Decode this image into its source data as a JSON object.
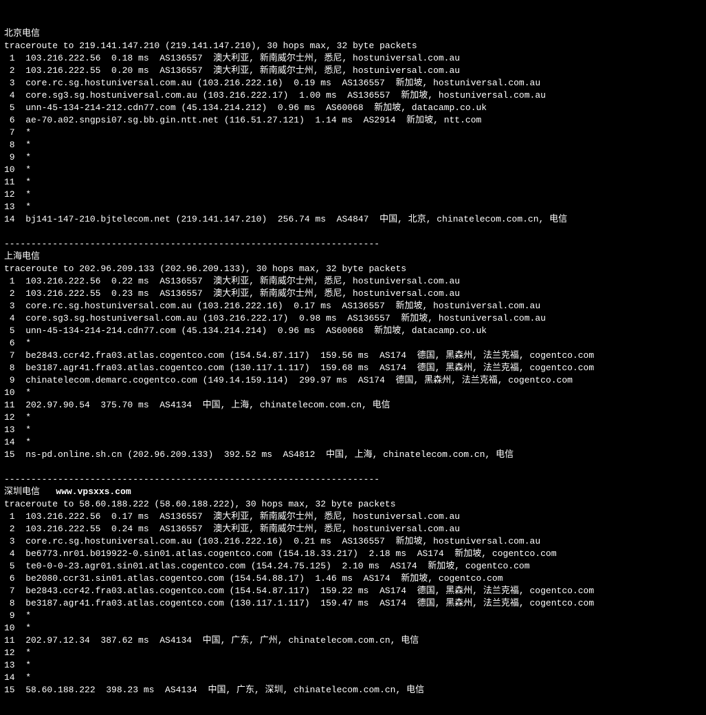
{
  "separator": "----------------------------------------------------------------------",
  "sections": [
    {
      "title": "北京电信",
      "watermark": "",
      "header": "traceroute to 219.141.147.210 (219.141.147.210), 30 hops max, 32 byte packets",
      "hops": [
        {
          "n": 1,
          "text": "103.216.222.56  0.18 ms  AS136557  澳大利亚, 新南威尔士州, 悉尼, hostuniversal.com.au"
        },
        {
          "n": 2,
          "text": "103.216.222.55  0.20 ms  AS136557  澳大利亚, 新南威尔士州, 悉尼, hostuniversal.com.au"
        },
        {
          "n": 3,
          "text": "core.rc.sg.hostuniversal.com.au (103.216.222.16)  0.19 ms  AS136557  新加坡, hostuniversal.com.au"
        },
        {
          "n": 4,
          "text": "core.sg3.sg.hostuniversal.com.au (103.216.222.17)  1.00 ms  AS136557  新加坡, hostuniversal.com.au"
        },
        {
          "n": 5,
          "text": "unn-45-134-214-212.cdn77.com (45.134.214.212)  0.96 ms  AS60068  新加坡, datacamp.co.uk"
        },
        {
          "n": 6,
          "text": "ae-70.a02.sngpsi07.sg.bb.gin.ntt.net (116.51.27.121)  1.14 ms  AS2914  新加坡, ntt.com"
        },
        {
          "n": 7,
          "text": "*"
        },
        {
          "n": 8,
          "text": "*"
        },
        {
          "n": 9,
          "text": "*"
        },
        {
          "n": 10,
          "text": "*"
        },
        {
          "n": 11,
          "text": "*"
        },
        {
          "n": 12,
          "text": "*"
        },
        {
          "n": 13,
          "text": "*"
        },
        {
          "n": 14,
          "text": "bj141-147-210.bjtelecom.net (219.141.147.210)  256.74 ms  AS4847  中国, 北京, chinatelecom.com.cn, 电信"
        }
      ]
    },
    {
      "title": "上海电信",
      "watermark": "",
      "header": "traceroute to 202.96.209.133 (202.96.209.133), 30 hops max, 32 byte packets",
      "hops": [
        {
          "n": 1,
          "text": "103.216.222.56  0.22 ms  AS136557  澳大利亚, 新南威尔士州, 悉尼, hostuniversal.com.au"
        },
        {
          "n": 2,
          "text": "103.216.222.55  0.23 ms  AS136557  澳大利亚, 新南威尔士州, 悉尼, hostuniversal.com.au"
        },
        {
          "n": 3,
          "text": "core.rc.sg.hostuniversal.com.au (103.216.222.16)  0.17 ms  AS136557  新加坡, hostuniversal.com.au"
        },
        {
          "n": 4,
          "text": "core.sg3.sg.hostuniversal.com.au (103.216.222.17)  0.98 ms  AS136557  新加坡, hostuniversal.com.au"
        },
        {
          "n": 5,
          "text": "unn-45-134-214-214.cdn77.com (45.134.214.214)  0.96 ms  AS60068  新加坡, datacamp.co.uk"
        },
        {
          "n": 6,
          "text": "*"
        },
        {
          "n": 7,
          "text": "be2843.ccr42.fra03.atlas.cogentco.com (154.54.87.117)  159.56 ms  AS174  德国, 黑森州, 法兰克福, cogentco.com"
        },
        {
          "n": 8,
          "text": "be3187.agr41.fra03.atlas.cogentco.com (130.117.1.117)  159.68 ms  AS174  德国, 黑森州, 法兰克福, cogentco.com"
        },
        {
          "n": 9,
          "text": "chinatelecom.demarc.cogentco.com (149.14.159.114)  299.97 ms  AS174  德国, 黑森州, 法兰克福, cogentco.com"
        },
        {
          "n": 10,
          "text": "*"
        },
        {
          "n": 11,
          "text": "202.97.90.54  375.70 ms  AS4134  中国, 上海, chinatelecom.com.cn, 电信"
        },
        {
          "n": 12,
          "text": "*"
        },
        {
          "n": 13,
          "text": "*"
        },
        {
          "n": 14,
          "text": "*"
        },
        {
          "n": 15,
          "text": "ns-pd.online.sh.cn (202.96.209.133)  392.52 ms  AS4812  中国, 上海, chinatelecom.com.cn, 电信"
        }
      ]
    },
    {
      "title": "深圳电信",
      "watermark": "www.vpsxxs.com",
      "header": "traceroute to 58.60.188.222 (58.60.188.222), 30 hops max, 32 byte packets",
      "hops": [
        {
          "n": 1,
          "text": "103.216.222.56  0.17 ms  AS136557  澳大利亚, 新南威尔士州, 悉尼, hostuniversal.com.au"
        },
        {
          "n": 2,
          "text": "103.216.222.55  0.24 ms  AS136557  澳大利亚, 新南威尔士州, 悉尼, hostuniversal.com.au"
        },
        {
          "n": 3,
          "text": "core.rc.sg.hostuniversal.com.au (103.216.222.16)  0.21 ms  AS136557  新加坡, hostuniversal.com.au"
        },
        {
          "n": 4,
          "text": "be6773.nr01.b019922-0.sin01.atlas.cogentco.com (154.18.33.217)  2.18 ms  AS174  新加坡, cogentco.com"
        },
        {
          "n": 5,
          "text": "te0-0-0-23.agr01.sin01.atlas.cogentco.com (154.24.75.125)  2.10 ms  AS174  新加坡, cogentco.com"
        },
        {
          "n": 6,
          "text": "be2080.ccr31.sin01.atlas.cogentco.com (154.54.88.17)  1.46 ms  AS174  新加坡, cogentco.com"
        },
        {
          "n": 7,
          "text": "be2843.ccr42.fra03.atlas.cogentco.com (154.54.87.117)  159.22 ms  AS174  德国, 黑森州, 法兰克福, cogentco.com"
        },
        {
          "n": 8,
          "text": "be3187.agr41.fra03.atlas.cogentco.com (130.117.1.117)  159.47 ms  AS174  德国, 黑森州, 法兰克福, cogentco.com"
        },
        {
          "n": 9,
          "text": "*"
        },
        {
          "n": 10,
          "text": "*"
        },
        {
          "n": 11,
          "text": "202.97.12.34  387.62 ms  AS4134  中国, 广东, 广州, chinatelecom.com.cn, 电信"
        },
        {
          "n": 12,
          "text": "*"
        },
        {
          "n": 13,
          "text": "*"
        },
        {
          "n": 14,
          "text": "*"
        },
        {
          "n": 15,
          "text": "58.60.188.222  398.23 ms  AS4134  中国, 广东, 深圳, chinatelecom.com.cn, 电信"
        }
      ]
    }
  ]
}
